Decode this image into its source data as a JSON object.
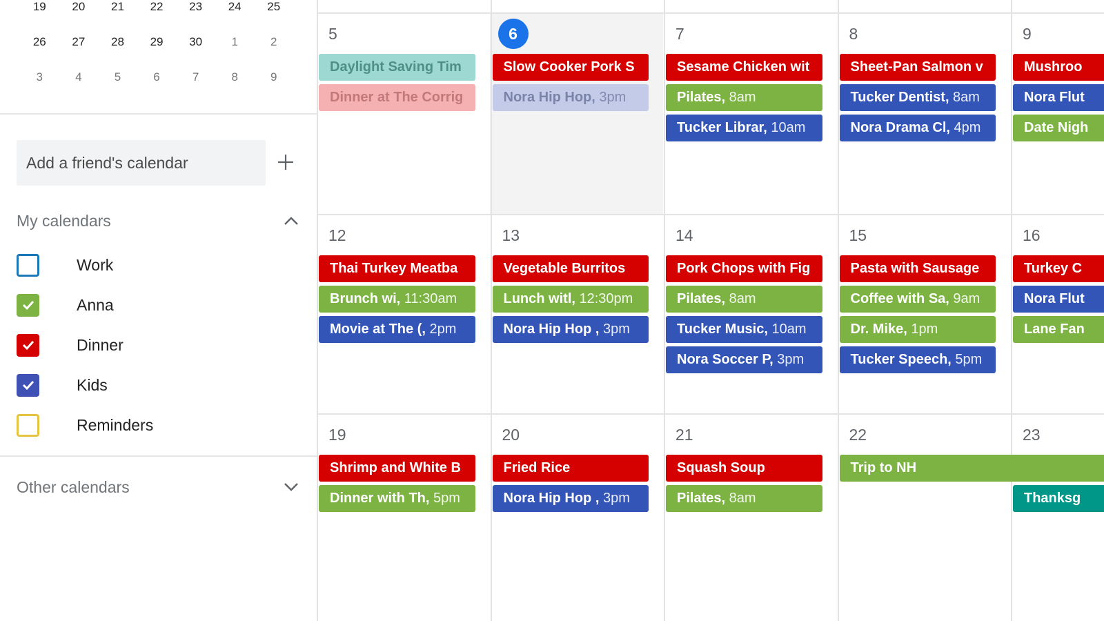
{
  "colors": {
    "dinner": "#d50000",
    "anna": "#7cb342",
    "kids": "#3f51b5",
    "kids_event": "#3355b8",
    "work": "#039be5",
    "reminders": "#e4c441",
    "holiday_teal": "#009688",
    "daylight": "#9ed8d2",
    "today_accent": "#1a73e8"
  },
  "mini_calendar": {
    "rows": [
      [
        {
          "d": "19",
          "other": false
        },
        {
          "d": "20",
          "other": false
        },
        {
          "d": "21",
          "other": false
        },
        {
          "d": "22",
          "other": false
        },
        {
          "d": "23",
          "other": false
        },
        {
          "d": "24",
          "other": false
        },
        {
          "d": "25",
          "other": false
        }
      ],
      [
        {
          "d": "26",
          "other": false
        },
        {
          "d": "27",
          "other": false
        },
        {
          "d": "28",
          "other": false
        },
        {
          "d": "29",
          "other": false
        },
        {
          "d": "30",
          "other": false
        },
        {
          "d": "1",
          "other": true
        },
        {
          "d": "2",
          "other": true
        }
      ],
      [
        {
          "d": "3",
          "other": true
        },
        {
          "d": "4",
          "other": true
        },
        {
          "d": "5",
          "other": true
        },
        {
          "d": "6",
          "other": true
        },
        {
          "d": "7",
          "other": true
        },
        {
          "d": "8",
          "other": true
        },
        {
          "d": "9",
          "other": true
        }
      ]
    ]
  },
  "sidebar": {
    "add_friend_placeholder": "Add a friend's calendar",
    "add_icon": "plus-icon",
    "my_calendars_label": "My calendars",
    "my_calendars_icon": "chevron-up-icon",
    "calendars": [
      {
        "label": "Work",
        "checked": false,
        "color": "#1a78b8"
      },
      {
        "label": "Anna",
        "checked": true,
        "color": "#7cb342"
      },
      {
        "label": "Dinner",
        "checked": true,
        "color": "#d50000"
      },
      {
        "label": "Kids",
        "checked": true,
        "color": "#3f51b5"
      },
      {
        "label": "Reminders",
        "checked": false,
        "color": "#e4c441"
      }
    ],
    "other_calendars_label": "Other calendars",
    "other_calendars_icon": "chevron-down-icon"
  },
  "month": {
    "weeks": [
      {
        "days": [
          {
            "num": "5",
            "today": false,
            "events": [
              {
                "title": "Daylight Saving Tim",
                "time": "",
                "color": "#9ed8d2",
                "text": "#4e8f88",
                "faded": false
              },
              {
                "title": "Dinner at The Corrig",
                "time": "",
                "color": "#f5b1b1",
                "text": "#c47979",
                "faded": false
              }
            ]
          },
          {
            "num": "6",
            "today": true,
            "events": [
              {
                "title": "Slow Cooker Pork S",
                "time": "",
                "color": "#d50000",
                "text": "#ffffff",
                "faded": false
              },
              {
                "title": "Nora Hip Hop,",
                "time": "3pm",
                "color": "#c4cbe8",
                "text": "#7a83a8",
                "faded": false
              }
            ]
          },
          {
            "num": "7",
            "today": false,
            "events": [
              {
                "title": "Sesame Chicken wit",
                "time": "",
                "color": "#d50000",
                "text": "#ffffff",
                "faded": false
              },
              {
                "title": "Pilates,",
                "time": "8am",
                "color": "#7cb342",
                "text": "#ffffff",
                "faded": false
              },
              {
                "title": "Tucker Librar,",
                "time": "10am",
                "color": "#3355b8",
                "text": "#ffffff",
                "faded": false
              }
            ]
          },
          {
            "num": "8",
            "today": false,
            "events": [
              {
                "title": "Sheet-Pan Salmon v",
                "time": "",
                "color": "#d50000",
                "text": "#ffffff",
                "faded": false
              },
              {
                "title": "Tucker Dentist,",
                "time": "8am",
                "color": "#3355b8",
                "text": "#ffffff",
                "faded": false
              },
              {
                "title": "Nora Drama Cl,",
                "time": "4pm",
                "color": "#3355b8",
                "text": "#ffffff",
                "faded": false
              }
            ]
          },
          {
            "num": "9",
            "today": false,
            "events": [
              {
                "title": "Mushroo",
                "time": "",
                "color": "#d50000",
                "text": "#ffffff",
                "faded": false
              },
              {
                "title": "Nora Flut",
                "time": "",
                "color": "#3355b8",
                "text": "#ffffff",
                "faded": false
              },
              {
                "title": "Date Nigh",
                "time": "",
                "color": "#7cb342",
                "text": "#ffffff",
                "faded": false
              }
            ]
          }
        ]
      },
      {
        "days": [
          {
            "num": "12",
            "today": false,
            "events": [
              {
                "title": "Thai Turkey Meatba",
                "time": "",
                "color": "#d50000",
                "text": "#ffffff",
                "faded": false
              },
              {
                "title": "Brunch wi,",
                "time": "11:30am",
                "color": "#7cb342",
                "text": "#ffffff",
                "faded": false
              },
              {
                "title": "Movie at The (,",
                "time": "2pm",
                "color": "#3355b8",
                "text": "#ffffff",
                "faded": false
              }
            ]
          },
          {
            "num": "13",
            "today": false,
            "events": [
              {
                "title": "Vegetable Burritos",
                "time": "",
                "color": "#d50000",
                "text": "#ffffff",
                "faded": false
              },
              {
                "title": "Lunch witl,",
                "time": "12:30pm",
                "color": "#7cb342",
                "text": "#ffffff",
                "faded": false
              },
              {
                "title": "Nora Hip Hop ,",
                "time": "3pm",
                "color": "#3355b8",
                "text": "#ffffff",
                "faded": false
              }
            ]
          },
          {
            "num": "14",
            "today": false,
            "events": [
              {
                "title": "Pork Chops with Fig",
                "time": "",
                "color": "#d50000",
                "text": "#ffffff",
                "faded": false
              },
              {
                "title": "Pilates,",
                "time": "8am",
                "color": "#7cb342",
                "text": "#ffffff",
                "faded": false
              },
              {
                "title": "Tucker Music,",
                "time": "10am",
                "color": "#3355b8",
                "text": "#ffffff",
                "faded": false
              },
              {
                "title": "Nora Soccer P,",
                "time": "3pm",
                "color": "#3355b8",
                "text": "#ffffff",
                "faded": false
              }
            ]
          },
          {
            "num": "15",
            "today": false,
            "events": [
              {
                "title": "Pasta with Sausage",
                "time": "",
                "color": "#d50000",
                "text": "#ffffff",
                "faded": false
              },
              {
                "title": "Coffee with Sa,",
                "time": "9am",
                "color": "#7cb342",
                "text": "#ffffff",
                "faded": false
              },
              {
                "title": "Dr. Mike,",
                "time": "1pm",
                "color": "#7cb342",
                "text": "#ffffff",
                "faded": false
              },
              {
                "title": "Tucker Speech,",
                "time": "5pm",
                "color": "#3355b8",
                "text": "#ffffff",
                "faded": false
              }
            ]
          },
          {
            "num": "16",
            "today": false,
            "events": [
              {
                "title": "Turkey C",
                "time": "",
                "color": "#d50000",
                "text": "#ffffff",
                "faded": false
              },
              {
                "title": "Nora Flut",
                "time": "",
                "color": "#3355b8",
                "text": "#ffffff",
                "faded": false
              },
              {
                "title": "Lane Fan",
                "time": "",
                "color": "#7cb342",
                "text": "#ffffff",
                "faded": false
              }
            ]
          }
        ]
      },
      {
        "days": [
          {
            "num": "19",
            "today": false,
            "events": [
              {
                "title": "Shrimp and White B",
                "time": "",
                "color": "#d50000",
                "text": "#ffffff",
                "faded": false
              },
              {
                "title": "Dinner with Th,",
                "time": "5pm",
                "color": "#7cb342",
                "text": "#ffffff",
                "faded": false
              }
            ]
          },
          {
            "num": "20",
            "today": false,
            "events": [
              {
                "title": "Fried Rice",
                "time": "",
                "color": "#d50000",
                "text": "#ffffff",
                "faded": false
              },
              {
                "title": "Nora Hip Hop ,",
                "time": "3pm",
                "color": "#3355b8",
                "text": "#ffffff",
                "faded": false
              }
            ]
          },
          {
            "num": "21",
            "today": false,
            "events": [
              {
                "title": "Squash Soup",
                "time": "",
                "color": "#d50000",
                "text": "#ffffff",
                "faded": false
              },
              {
                "title": "Pilates,",
                "time": "8am",
                "color": "#7cb342",
                "text": "#ffffff",
                "faded": false
              }
            ]
          },
          {
            "num": "22",
            "today": false,
            "events": [
              {
                "title": "Trip to NH",
                "time": "",
                "color": "#7cb342",
                "text": "#ffffff",
                "faded": false,
                "span": 2
              }
            ]
          },
          {
            "num": "23",
            "today": false,
            "events": [
              {
                "title": "",
                "time": "",
                "color": "none",
                "text": "#ffffff",
                "faded": false,
                "placeholder": true
              },
              {
                "title": "Thanksg",
                "time": "",
                "color": "#009688",
                "text": "#ffffff",
                "faded": false
              }
            ]
          }
        ]
      }
    ]
  }
}
